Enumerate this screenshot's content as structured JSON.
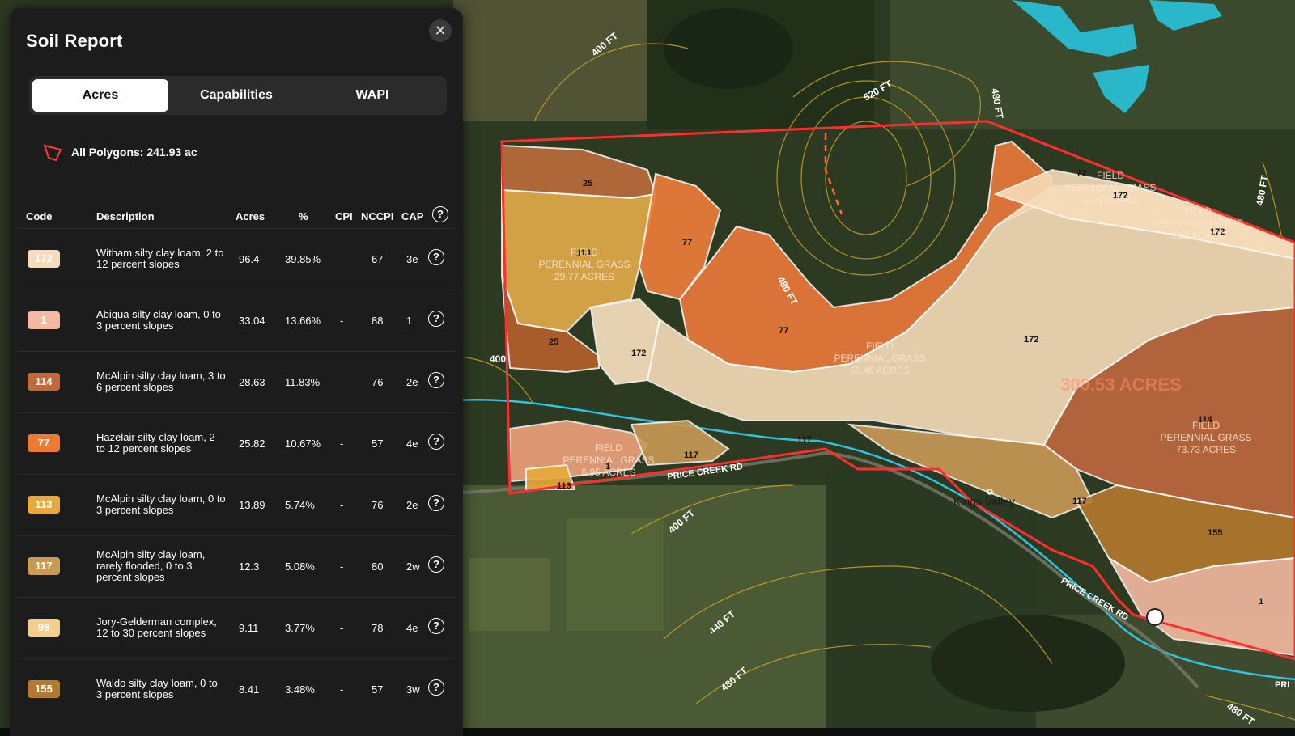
{
  "panel": {
    "title": "Soil Report",
    "tabs": [
      {
        "label": "Acres",
        "active": true
      },
      {
        "label": "Capabilities",
        "active": false
      },
      {
        "label": "WAPI",
        "active": false
      }
    ],
    "polygons_summary": "All Polygons: 241.93 ac",
    "columns": [
      "Code",
      "Description",
      "Acres",
      "%",
      "CPI",
      "NCCPI",
      "CAP"
    ],
    "rows": [
      {
        "code": "172",
        "color": "#f6dcbd",
        "description": "Witham silty clay loam, 2 to 12 percent slopes",
        "acres": "96.4",
        "percent": "39.85%",
        "cpi": "-",
        "nccpi": "67",
        "cap": "3e"
      },
      {
        "code": "1",
        "color": "#f4b9a0",
        "description": "Abiqua silty clay loam, 0 to 3 percent slopes",
        "acres": "33.04",
        "percent": "13.66%",
        "cpi": "-",
        "nccpi": "88",
        "cap": "1"
      },
      {
        "code": "114",
        "color": "#c0693f",
        "description": "McAlpin silty clay loam, 3 to 6 percent slopes",
        "acres": "28.63",
        "percent": "11.83%",
        "cpi": "-",
        "nccpi": "76",
        "cap": "2e"
      },
      {
        "code": "77",
        "color": "#ec7a35",
        "description": "Hazelair silty clay loam, 2 to 12 percent slopes",
        "acres": "25.82",
        "percent": "10.67%",
        "cpi": "-",
        "nccpi": "57",
        "cap": "4e"
      },
      {
        "code": "113",
        "color": "#e8a93a",
        "description": "McAlpin silty clay loam, 0 to 3 percent slopes",
        "acres": "13.89",
        "percent": "5.74%",
        "cpi": "-",
        "nccpi": "76",
        "cap": "2e"
      },
      {
        "code": "117",
        "color": "#c99a54",
        "description": "McAlpin silty clay loam, rarely flooded, 0 to 3 percent slopes",
        "acres": "12.3",
        "percent": "5.08%",
        "cpi": "-",
        "nccpi": "80",
        "cap": "2w"
      },
      {
        "code": "98",
        "color": "#f1cf91",
        "description": "Jory-Gelderman complex, 12 to 30 percent slopes",
        "acres": "9.11",
        "percent": "3.77%",
        "cpi": "-",
        "nccpi": "78",
        "cap": "4e"
      },
      {
        "code": "155",
        "color": "#b5792d",
        "description": "Waldo silty clay loam, 0 to 3 percent slopes",
        "acres": "8.41",
        "percent": "3.48%",
        "cpi": "-",
        "nccpi": "57",
        "cap": "3w"
      }
    ]
  },
  "map": {
    "contours": [
      "400 FT",
      "520 FT",
      "480 FT",
      "480 FT",
      "400",
      "400 FT",
      "440 FT",
      "480 FT",
      "480 FT",
      "480 FT"
    ],
    "soil_codes": [
      "25",
      "113",
      "77",
      "25",
      "172",
      "77",
      "172",
      "77",
      "172",
      "172",
      "114",
      "117",
      "117",
      "1",
      "113",
      "117",
      "155",
      "1"
    ],
    "fields": [
      {
        "line1": "FIELD",
        "line2": "PERENNIAL GRASS",
        "line3": "29.77 ACRES"
      },
      {
        "line1": "FIELD",
        "line2": "PERENNIAL GRASS",
        "line3": "65.46 ACRES"
      },
      {
        "line1": "FIELD",
        "line2": "PERENNIAL GRASS",
        "line3": "6.95 ACRES"
      },
      {
        "line1": "FIELD",
        "line2": "PERENNIAL GRASS",
        "line3": "1.96 ACRES"
      },
      {
        "line1": "FIELD",
        "line2": "PERENNIAL GRASS",
        "line3": "3.25 ACRES"
      },
      {
        "line1": "FIELD",
        "line2": "PERENNIAL GRASS",
        "line3": "73.73 ACRES"
      }
    ],
    "total_acres": "300.53 ACRES",
    "roads": [
      "PRICE CREEK RD",
      "PRICE CREEK RD",
      "PRI"
    ],
    "place": "Kings Valley"
  }
}
